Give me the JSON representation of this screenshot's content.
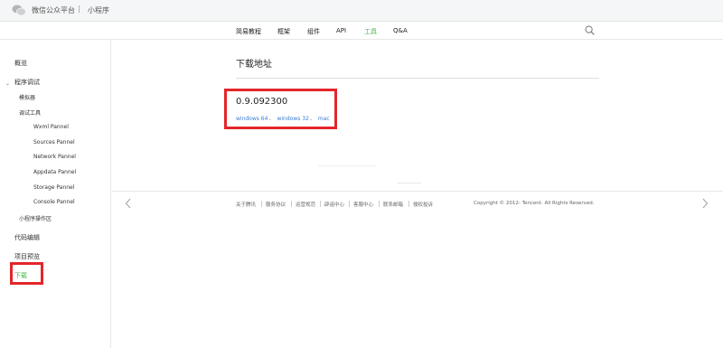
{
  "header": {
    "brand": "微信公众平台",
    "separator": "|",
    "section": "小程序"
  },
  "nav": {
    "items": [
      {
        "label": "简易教程"
      },
      {
        "label": "框架"
      },
      {
        "label": "组件"
      },
      {
        "label": "API"
      },
      {
        "label": "工具",
        "active": true
      },
      {
        "label": "Q&A"
      }
    ],
    "search_icon": "search-icon"
  },
  "sidebar": {
    "items": [
      {
        "label": "概览"
      },
      {
        "label": "程序调试"
      },
      {
        "label": "模拟器"
      },
      {
        "label": "调试工具"
      },
      {
        "label": "Wxml Pannel"
      },
      {
        "label": "Sources Pannel"
      },
      {
        "label": "Network Pannel"
      },
      {
        "label": "Appdata Pannel"
      },
      {
        "label": "Storage Pannel"
      },
      {
        "label": "Console Pannel"
      },
      {
        "label": "小程序操作区"
      },
      {
        "label": "代码编辑"
      },
      {
        "label": "项目预览"
      },
      {
        "label": "下载",
        "active": true
      }
    ]
  },
  "main": {
    "title": "下载地址",
    "version": "0.9.092300",
    "downloads": [
      {
        "label": "windows 64"
      },
      {
        "label": "windows 32"
      },
      {
        "label": "mac"
      }
    ],
    "link_separator": "、"
  },
  "footer": {
    "links": [
      {
        "label": "关于腾讯"
      },
      {
        "label": "服务协议"
      },
      {
        "label": "运营规范"
      },
      {
        "label": "辟谣中心"
      },
      {
        "label": "客服中心"
      },
      {
        "label": "联系邮箱"
      },
      {
        "label": "侵权投诉"
      }
    ],
    "copyright": "Copyright © 2012- Tencent. All Rights Reserved."
  },
  "colors": {
    "accent": "#44b549",
    "link": "#3a7bd5",
    "highlight": "#e3262a"
  }
}
